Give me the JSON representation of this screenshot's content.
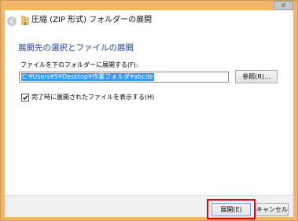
{
  "window": {
    "close_label": "x",
    "frame_color": "#f2b56b"
  },
  "header": {
    "title": "圧縮 (ZIP 形式) フォルダーの展開"
  },
  "main": {
    "heading": "展開先の選択とファイルの展開",
    "dest_label": "ファイルを下のフォルダーに展開する(F):",
    "path_value": "C:¥Users¥S¥Desktop¥作業フォルダ¥abcde",
    "browse_label": "参照(R)...",
    "show_files_label": "完了時に展開されたファイルを表示する(H)",
    "show_files_checked": true
  },
  "footer": {
    "extract_label": "展開(E)",
    "cancel_label": "キャンセル",
    "highlight_color": "#e0001b"
  }
}
